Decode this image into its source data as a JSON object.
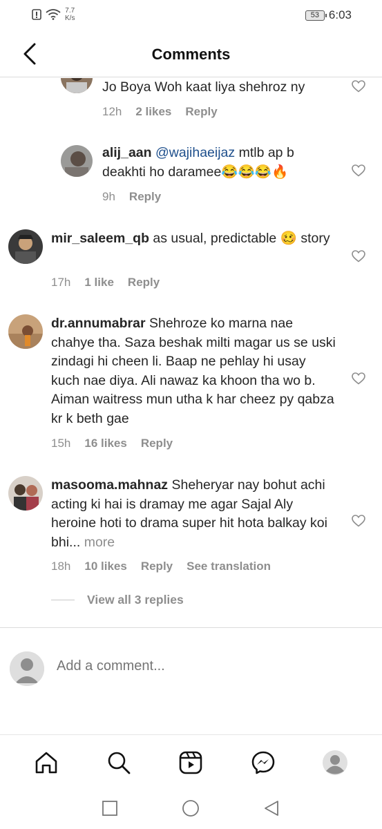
{
  "status_bar": {
    "speed_value": "7.7",
    "speed_unit": "K/s",
    "battery": "53",
    "time": "6:03"
  },
  "header": {
    "title": "Comments"
  },
  "comments": [
    {
      "username": "",
      "mention": "",
      "text": "Jo Boya Woh kaat liya shehroz ny",
      "time": "12h",
      "likes": "2 likes",
      "reply": "Reply"
    },
    {
      "username": "alij_aan",
      "mention": "@wajihaeijaz",
      "text": " mtlb ap b deakhti ho daramee😂😂😂🔥",
      "time": "9h",
      "likes": "",
      "reply": "Reply"
    },
    {
      "username": "mir_saleem_qb",
      "mention": "",
      "text": " as usual, predictable 🥴 story",
      "time": "17h",
      "likes": "1 like",
      "reply": "Reply"
    },
    {
      "username": "dr.annumabrar",
      "mention": "",
      "text": " Shehroze ko marna nae chahye tha. Saza beshak milti magar us se uski zindagi hi cheen li. Baap ne pehlay hi usay kuch nae diya. Ali nawaz ka khoon tha wo b. Aiman waitress mun utha k har cheez py qabza kr k beth gae",
      "time": "15h",
      "likes": "16 likes",
      "reply": "Reply"
    },
    {
      "username": "masooma.mahnaz",
      "mention": "",
      "text": " Sheheryar nay bohut achi acting ki hai is dramay me agar Sajal Aly heroine hoti to drama super hit hota balkay koi bhi...",
      "more": " more",
      "time": "18h",
      "likes": "10 likes",
      "reply": "Reply",
      "translate": "See translation"
    }
  ],
  "view_replies": "View all 3 replies",
  "add_comment": {
    "placeholder": "Add a comment..."
  },
  "nav": [
    "home-icon",
    "search-icon",
    "reels-icon",
    "messenger-icon",
    "profile-icon"
  ]
}
